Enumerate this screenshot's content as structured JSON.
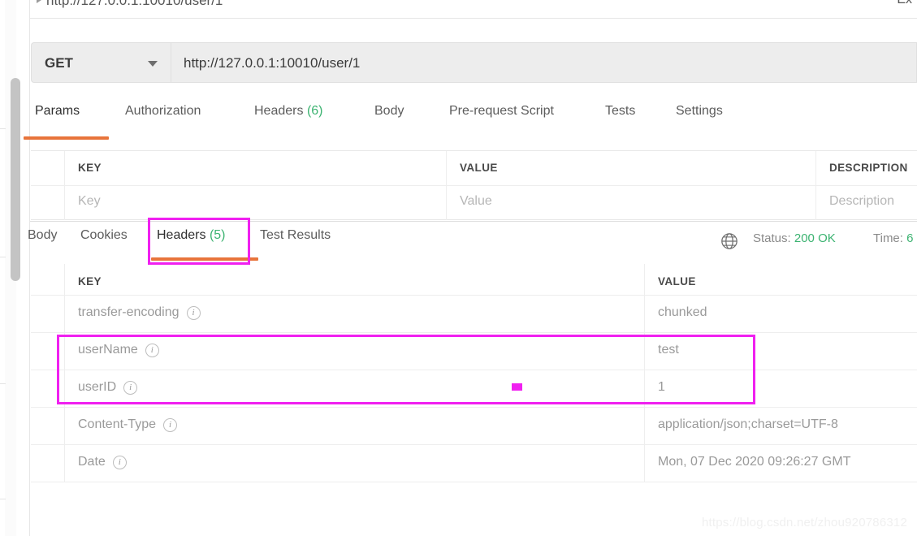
{
  "window": {
    "tab_title": "http://127.0.0.1:10010/user/1",
    "examples_label_cut": "Ex"
  },
  "request": {
    "method": "GET",
    "url": "http://127.0.0.1:10010/user/1",
    "tabs": [
      {
        "label": "Params",
        "count": "",
        "active": true
      },
      {
        "label": "Authorization",
        "count": "",
        "active": false
      },
      {
        "label": "Headers",
        "count": "(6)",
        "active": false
      },
      {
        "label": "Body",
        "count": "",
        "active": false
      },
      {
        "label": "Pre-request Script",
        "count": "",
        "active": false
      },
      {
        "label": "Tests",
        "count": "",
        "active": false
      },
      {
        "label": "Settings",
        "count": "",
        "active": false
      }
    ],
    "params_table": {
      "headers": [
        "KEY",
        "VALUE",
        "DESCRIPTION"
      ],
      "placeholder_row": [
        "Key",
        "Value",
        "Description"
      ]
    }
  },
  "response": {
    "tabs": [
      {
        "label": "Body",
        "count": "",
        "active": false
      },
      {
        "label": "Cookies",
        "count": "",
        "active": false
      },
      {
        "label": "Headers",
        "count": "(5)",
        "active": true
      },
      {
        "label": "Test Results",
        "count": "",
        "active": false
      }
    ],
    "status_label": "Status:",
    "status_value": "200 OK",
    "time_label": "Time:",
    "time_value": "6",
    "headers_table": {
      "columns": [
        "KEY",
        "VALUE"
      ],
      "rows": [
        {
          "key": "transfer-encoding",
          "value": "chunked"
        },
        {
          "key": "userName",
          "value": "test"
        },
        {
          "key": "userID",
          "value": "1"
        },
        {
          "key": "Content-Type",
          "value": "application/json;charset=UTF-8"
        },
        {
          "key": "Date",
          "value": "Mon, 07 Dec 2020 09:26:27 GMT"
        }
      ]
    }
  },
  "annotations": {
    "accent_color": "#f020f0",
    "highlight_tab": "Headers (5)",
    "highlight_rows": "userName / userID"
  },
  "watermark": "https://blog.csdn.net/zhou920786312"
}
